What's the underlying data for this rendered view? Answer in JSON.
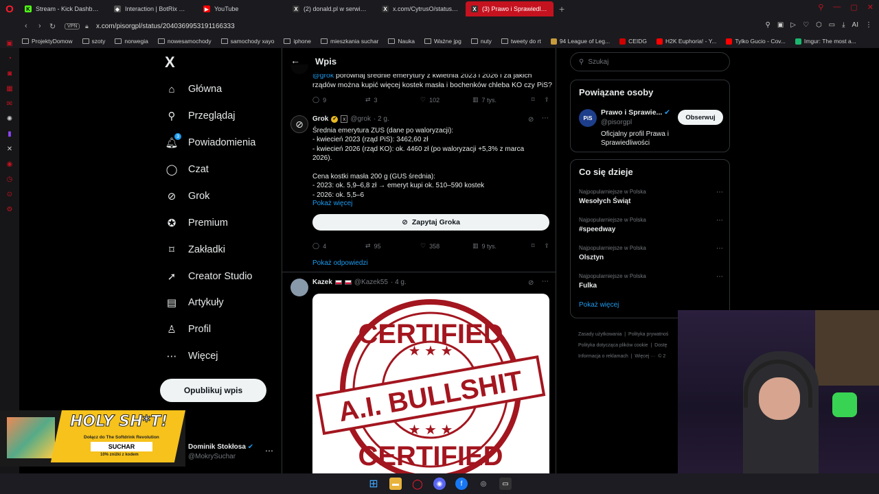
{
  "browser": {
    "tabs": [
      {
        "label": "Stream - Kick Dashboard",
        "color": "#53fc18",
        "glyph": "K"
      },
      {
        "label": "Interaction | BotRix — Clo",
        "color": "#555555",
        "glyph": "◆"
      },
      {
        "label": "YouTube",
        "color": "#ff0000",
        "glyph": "▶"
      },
      {
        "label": "(2) donald.pl w serwisie X",
        "color": "#333333",
        "glyph": "X"
      },
      {
        "label": "x.com/CytrusO/status/20",
        "color": "#333333",
        "glyph": "X"
      },
      {
        "label": "(3) Prawo i Sprawiedliwość",
        "color": "#333333",
        "glyph": "X"
      }
    ],
    "vpn_label": "VPN",
    "url": "x.com/pisorgpl/status/2040369953191166333",
    "ai_label": "AI",
    "bookmarks": [
      {
        "label": "ProjektyDomow",
        "type": "folder"
      },
      {
        "label": "szoty",
        "type": "folder"
      },
      {
        "label": "norwegia",
        "type": "folder"
      },
      {
        "label": "nowesamochody",
        "type": "folder"
      },
      {
        "label": "samochody xayo",
        "type": "folder"
      },
      {
        "label": "iphone",
        "type": "folder"
      },
      {
        "label": "mieszkania suchar",
        "type": "folder"
      },
      {
        "label": "Nauka",
        "type": "folder"
      },
      {
        "label": "Ważne jpg",
        "type": "folder"
      },
      {
        "label": "nuty",
        "type": "folder"
      },
      {
        "label": "tweety do rt",
        "type": "folder"
      },
      {
        "label": "94 League of Leg...",
        "type": "site",
        "color": "#c89b3c"
      },
      {
        "label": "CEIDG",
        "type": "site",
        "color": "#d00000"
      },
      {
        "label": "H2K Euphoria! - Y...",
        "type": "site",
        "color": "#ff0000"
      },
      {
        "label": "Tylko Gucio - Cov...",
        "type": "site",
        "color": "#ff0000"
      },
      {
        "label": "Imgur: The most a...",
        "type": "site",
        "color": "#1bb76e"
      }
    ]
  },
  "nav": {
    "logo": "X",
    "items": [
      {
        "label": "Główna",
        "icon": "home-icon",
        "glyph": "⌂"
      },
      {
        "label": "Przeglądaj",
        "icon": "search-icon",
        "glyph": "⚲"
      },
      {
        "label": "Powiadomienia",
        "icon": "bell-icon",
        "glyph": "🔔︎",
        "badge": "3"
      },
      {
        "label": "Czat",
        "icon": "chat-icon",
        "glyph": "◯"
      },
      {
        "label": "Grok",
        "icon": "grok-icon",
        "glyph": "⊘"
      },
      {
        "label": "Premium",
        "icon": "premium-icon",
        "glyph": "✪"
      },
      {
        "label": "Zakładki",
        "icon": "bookmark-icon",
        "glyph": "⌑"
      },
      {
        "label": "Creator Studio",
        "icon": "rocket-icon",
        "glyph": "➚"
      },
      {
        "label": "Artykuły",
        "icon": "article-icon",
        "glyph": "▤"
      },
      {
        "label": "Profil",
        "icon": "profile-icon",
        "glyph": "♙"
      },
      {
        "label": "Więcej",
        "icon": "more-icon",
        "glyph": "⋯"
      }
    ],
    "post_button": "Opublikuj wpis",
    "account_name": "Dominik Stokłosa",
    "account_handle": "@MokrySuchar"
  },
  "ad": {
    "title": "HOLY SH*T!",
    "subtitle": "Dołącz do The Softdrink Revolution",
    "code": "SUCHAR",
    "discount": "10% zniżki z kodem"
  },
  "feed": {
    "header_title": "Wpis",
    "tweet1": {
      "mention": "@grok",
      "text": " porównaj średnie emerytury z kwietnia 2023 i 2026 i za jakich rządów można kupić więcej kostek masła i bochenków chleba KO czy PiS?",
      "replies": "9",
      "retweets": "3",
      "likes": "102",
      "views": "7 tys."
    },
    "tweet2": {
      "name": "Grok",
      "handle": "@grok",
      "time": "· 2 g.",
      "text": "Średnia emerytura ZUS (dane po waloryzacji):\n- kwiecień 2023 (rząd PiS): 3462,60 zł\n- kwiecień 2026 (rząd KO): ok. 4460 zł (po waloryzacji +5,3% z marca 2026).\n\nCena kostki masła 200 g (GUS średnia):\n- 2023: ok. 5,9–6,8 zł → emeryt kupi ok. 510–590 kostek\n- 2026: ok. 5,5–6",
      "show_more": "Pokaż więcej",
      "ask_button": "Zapytaj Groka",
      "replies": "4",
      "retweets": "95",
      "likes": "358",
      "views": "9 tys."
    },
    "show_replies": "Pokaż odpowiedzi",
    "tweet3": {
      "name": "Kazek",
      "handle": "@Kazek55",
      "time": "· 4 g.",
      "image_text_top": "CERTIFIED",
      "image_text_middle": "A.I. BULLSHIT",
      "image_text_bottom": "CERTIFIED"
    }
  },
  "right": {
    "search_placeholder": "Szukaj",
    "related_title": "Powiązane osoby",
    "related": {
      "name": "Prawo i Sprawie...",
      "handle": "@pisorgpl",
      "bio": "Oficjalny profil Prawa i Sprawiedliwości",
      "avatar_text": "PiS",
      "follow": "Obserwuj"
    },
    "trends_title": "Co się dzieje",
    "trends": [
      {
        "category": "Najpopularniejsze w Polska",
        "name": "Wesołych Świąt"
      },
      {
        "category": "Najpopularniejsze w Polska",
        "name": "#speedway"
      },
      {
        "category": "Najpopularniejsze w Polska",
        "name": "Olsztyn"
      },
      {
        "category": "Najpopularniejsze w Polska",
        "name": "Fulka"
      }
    ],
    "show_more": "Pokaż więcej",
    "footer": [
      "Zasady użytkowania",
      "Polityka prywatnoś",
      "Polityka dotycząca plików cookie",
      "Dostę",
      "Informacja o reklamach",
      "Więcej ···",
      "© 2"
    ]
  },
  "colors": {
    "accent": "#1d9bf0",
    "opera_red": "#c5121f",
    "border": "#2f3336",
    "muted": "#71767b"
  }
}
